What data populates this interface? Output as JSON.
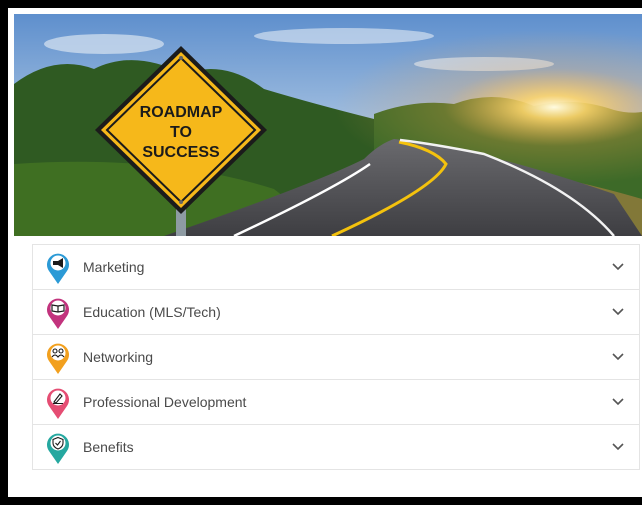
{
  "hero": {
    "sign_lines": [
      "ROADMAP",
      "TO",
      "SUCCESS"
    ]
  },
  "accordion": {
    "items": [
      {
        "label": "Marketing",
        "icon": "megaphone-icon",
        "color": "#2b9ad6"
      },
      {
        "label": "Education (MLS/Tech)",
        "icon": "book-icon",
        "color": "#c2337d"
      },
      {
        "label": "Networking",
        "icon": "people-icon",
        "color": "#f2a01e"
      },
      {
        "label": "Professional Development",
        "icon": "pen-icon",
        "color": "#e54d73"
      },
      {
        "label": "Benefits",
        "icon": "shield-check-icon",
        "color": "#25a8a0"
      }
    ]
  },
  "colors": {
    "sign_yellow": "#f6b81a",
    "road_line": "#f4c20d",
    "sky": "#6f9fd6"
  }
}
